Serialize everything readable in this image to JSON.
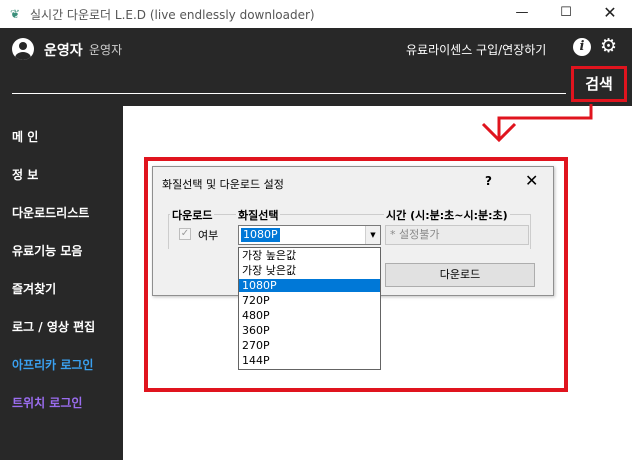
{
  "window": {
    "title": "실시간 다운로더 L.E.D (live endlessly downloader)",
    "minimize": "—",
    "maximize": "☐",
    "close": "✕",
    "app_icon": "leaf-app-icon"
  },
  "header": {
    "user_name": "운영자",
    "user_role": "운영자",
    "license_link": "유료라이센스 구입/연장하기",
    "info_icon": "i",
    "settings_icon": "⚙",
    "search_placeholder": "",
    "search_button": "검색"
  },
  "sidebar": {
    "items": [
      {
        "label": "메 인",
        "color": "#ffffff"
      },
      {
        "label": "정 보",
        "color": "#ffffff"
      },
      {
        "label": "다운로드리스트",
        "color": "#ffffff"
      },
      {
        "label": "유료기능 모음",
        "color": "#ffffff"
      },
      {
        "label": "즐겨찾기",
        "color": "#ffffff"
      },
      {
        "label": "로그 / 영상 편집",
        "color": "#ffffff"
      },
      {
        "label": "아프리카 로그인",
        "color": "#3aa0f0"
      },
      {
        "label": "트위치 로그인",
        "color": "#9b6df0"
      }
    ]
  },
  "dialog": {
    "title": "화질선택 및 다운로드 설정",
    "help": "?",
    "close": "✕",
    "download_group_label": "다운로드",
    "checkbox_label": "여부",
    "checkbox_checked": true,
    "quality_group_label": "화질선택",
    "quality_selected": "1080P",
    "time_group_label": "시간 (시:분:초~시:분:초)",
    "time_placeholder": "* 설정불가",
    "download_button": "다운로드"
  },
  "dropdown": {
    "options": [
      "가장 높은값",
      "가장 낮은값",
      "1080P",
      "720P",
      "480P",
      "360P",
      "270P",
      "144P"
    ],
    "selected_index": 2
  },
  "annotation": {
    "color": "#e0141e"
  }
}
